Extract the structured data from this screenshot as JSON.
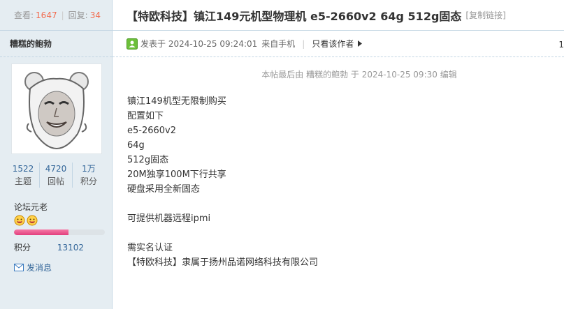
{
  "thread_stats": {
    "views_label": "查看:",
    "views": "1647",
    "replies_label": "回复:",
    "replies": "34"
  },
  "thread": {
    "title": "【特欧科技】镇江149元机型物理机 e5-2660v2 64g 512g固态",
    "copy_link": "[复制链接]"
  },
  "author": {
    "name": "糟糕的鲍勃",
    "stats": [
      {
        "value": "1522",
        "label": "主题"
      },
      {
        "value": "4720",
        "label": "回帖"
      },
      {
        "value": "1万",
        "label": "积分"
      }
    ],
    "rank": "论坛元老",
    "rank_progress": 0.6,
    "points_label": "积分",
    "points_value": "13102",
    "send_message": "发消息"
  },
  "post": {
    "posted_on": "发表于 2024-10-25 09:24:01",
    "source": "来自手机",
    "only_author": "只看该作者",
    "floor_number": "1",
    "edit_note": "本帖最后由 糟糕的鲍勃 于 2024-10-25 09:30 编辑",
    "lines": [
      "镇江149机型无限制购买",
      "配置如下",
      "e5-2660v2",
      "64g",
      "512g固态",
      "20M独享100M下行共享",
      "硬盘采用全新固态",
      "",
      "可提供机器远程ipmi",
      "",
      "需实名认证",
      "【特欧科技】隶属于扬州品诺网络科技有限公司"
    ]
  },
  "colors": {
    "sidebar_bg": "#e5edf2",
    "border": "#c2d5e3",
    "link_blue": "#336699",
    "stat_orange": "#f26c4f",
    "progress_pink": "#e23f7d"
  }
}
